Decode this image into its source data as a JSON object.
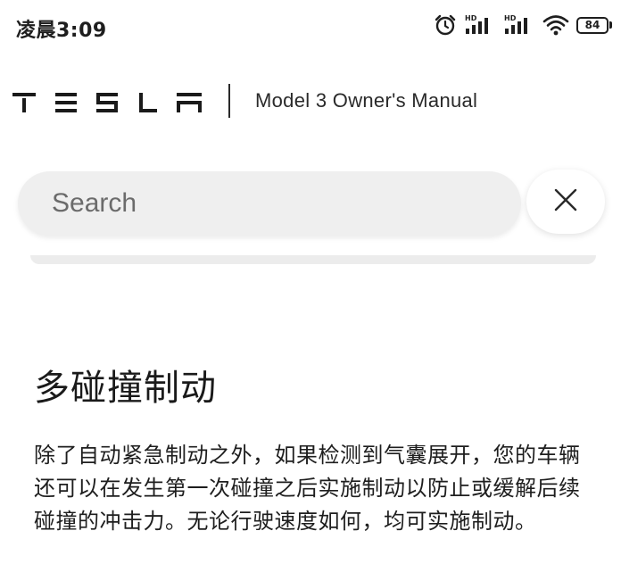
{
  "status_bar": {
    "time": "凌晨3:09",
    "icons": [
      "alarm-icon",
      "hd-signal-icon",
      "hd-signal-icon",
      "wifi-icon",
      "battery-icon"
    ],
    "battery_level": "84"
  },
  "header": {
    "brand": "TESLA",
    "title": "Model 3 Owner's Manual"
  },
  "search": {
    "placeholder": "Search",
    "value": "",
    "close_icon": "close-icon"
  },
  "article": {
    "title": "多碰撞制动",
    "body": "除了自动紧急制动之外，如果检测到气囊展开，您的车辆还可以在发生第一次碰撞之后实施制动以防止或缓解后续碰撞的冲击力。无论行驶速度如何，均可实施制动。"
  }
}
